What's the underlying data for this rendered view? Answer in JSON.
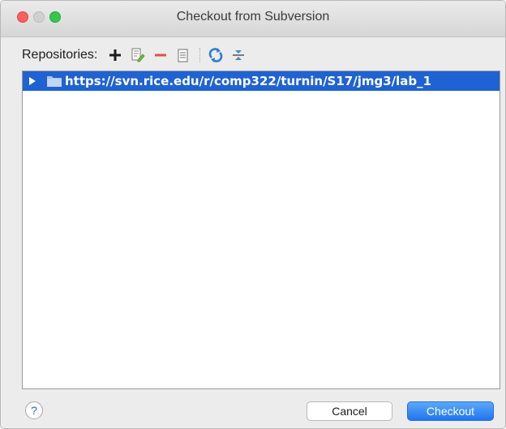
{
  "window": {
    "title": "Checkout from Subversion"
  },
  "toolbar": {
    "label": "Repositories:",
    "buttons": [
      {
        "name": "add",
        "icon": "plus-icon"
      },
      {
        "name": "edit",
        "icon": "edit-icon"
      },
      {
        "name": "remove",
        "icon": "minus-icon"
      },
      {
        "name": "browse",
        "icon": "document-icon"
      },
      {
        "name": "refresh",
        "icon": "refresh-icon"
      },
      {
        "name": "collapse",
        "icon": "collapse-icon"
      }
    ]
  },
  "repositories": [
    {
      "url": "https://svn.rice.edu/r/comp322/turnin/S17/jmg3/lab_1",
      "selected": true,
      "expanded": false
    }
  ],
  "footer": {
    "help_label": "?",
    "cancel_label": "Cancel",
    "checkout_label": "Checkout"
  },
  "colors": {
    "selection": "#1f62d3",
    "primary_button": "#2a7ef3",
    "remove_icon": "#d9534f",
    "refresh_icon": "#2a7fd4"
  }
}
